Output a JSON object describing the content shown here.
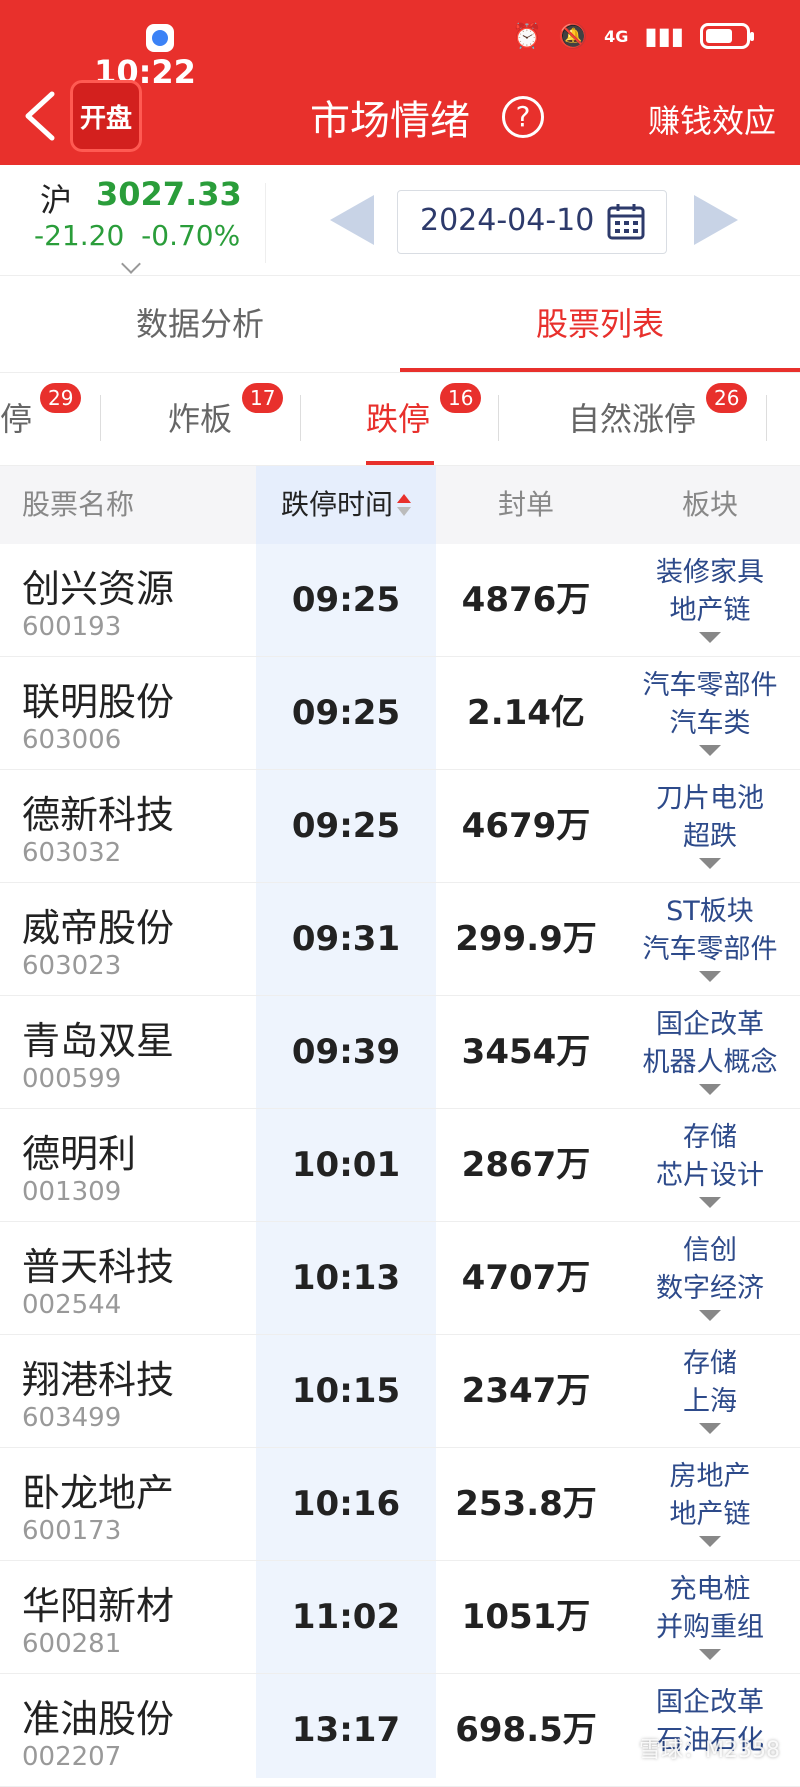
{
  "status_bar": {
    "time": "10:22",
    "network": "4G"
  },
  "header": {
    "logo_text": "开盘",
    "title": "市场情绪",
    "action": "赚钱效应"
  },
  "index": {
    "name": "沪",
    "value": "3027.33",
    "change": "-21.20",
    "change_pct": "-0.70%"
  },
  "date": "2024-04-10",
  "main_tabs": [
    {
      "label": "数据分析"
    },
    {
      "label": "股票列表"
    }
  ],
  "sub_tabs": [
    {
      "label": "停",
      "badge": "29"
    },
    {
      "label": "炸板",
      "badge": "17"
    },
    {
      "label": "跌停",
      "badge": "16"
    },
    {
      "label": "自然涨停",
      "badge": "26"
    }
  ],
  "table": {
    "headers": {
      "name": "股票名称",
      "time": "跌停时间",
      "seal": "封单",
      "sector": "板块"
    },
    "rows": [
      {
        "name": "创兴资源",
        "code": "600193",
        "time": "09:25",
        "seal": "4876万",
        "sector1": "装修家具",
        "sector2": "地产链"
      },
      {
        "name": "联明股份",
        "code": "603006",
        "time": "09:25",
        "seal": "2.14亿",
        "sector1": "汽车零部件",
        "sector2": "汽车类"
      },
      {
        "name": "德新科技",
        "code": "603032",
        "time": "09:25",
        "seal": "4679万",
        "sector1": "刀片电池",
        "sector2": "超跌"
      },
      {
        "name": "威帝股份",
        "code": "603023",
        "time": "09:31",
        "seal": "299.9万",
        "sector1": "ST板块",
        "sector2": "汽车零部件"
      },
      {
        "name": "青岛双星",
        "code": "000599",
        "time": "09:39",
        "seal": "3454万",
        "sector1": "国企改革",
        "sector2": "机器人概念"
      },
      {
        "name": "德明利",
        "code": "001309",
        "time": "10:01",
        "seal": "2867万",
        "sector1": "存储",
        "sector2": "芯片设计"
      },
      {
        "name": "普天科技",
        "code": "002544",
        "time": "10:13",
        "seal": "4707万",
        "sector1": "信创",
        "sector2": "数字经济"
      },
      {
        "name": "翔港科技",
        "code": "603499",
        "time": "10:15",
        "seal": "2347万",
        "sector1": "存储",
        "sector2": "上海"
      },
      {
        "name": "卧龙地产",
        "code": "600173",
        "time": "10:16",
        "seal": "253.8万",
        "sector1": "房地产",
        "sector2": "地产链"
      },
      {
        "name": "华阳新材",
        "code": "600281",
        "time": "11:02",
        "seal": "1051万",
        "sector1": "充电桩",
        "sector2": "并购重组"
      },
      {
        "name": "准油股份",
        "code": "002207",
        "time": "13:17",
        "seal": "698.5万",
        "sector1": "国企改革",
        "sector2": "石油石化"
      }
    ]
  },
  "watermark": "雪球：M2358",
  "colors": {
    "brand_red": "#e8302c",
    "down_green": "#2a9d3a",
    "sector_blue": "#2d4a8a",
    "time_col_bg": "#eef4fd"
  }
}
